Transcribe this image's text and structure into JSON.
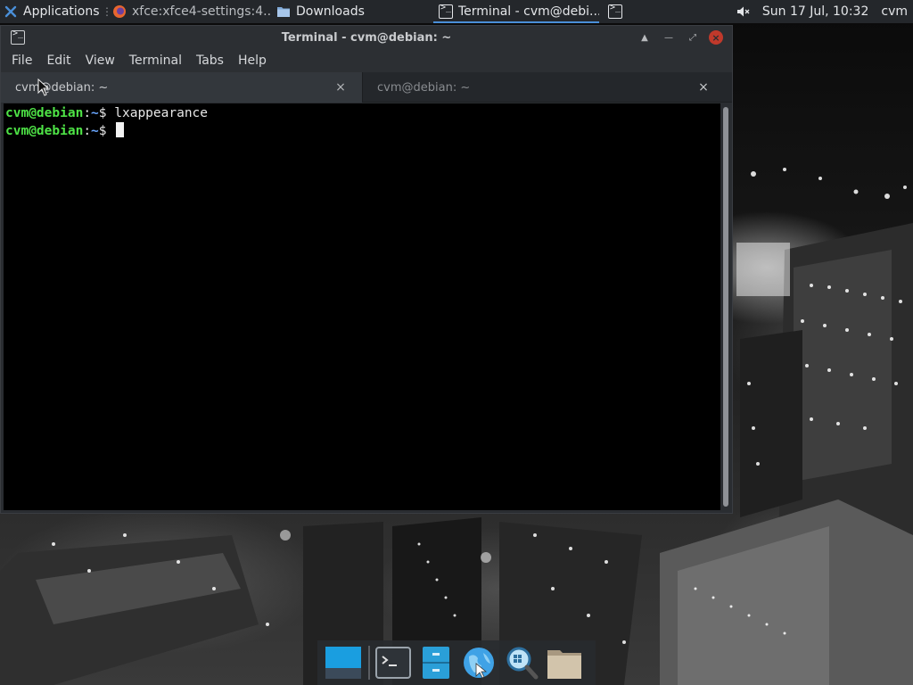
{
  "panel": {
    "applications_label": "Applications",
    "tasks": [
      {
        "label": "xfce:xfce4-settings:4...",
        "icon": "firefox-icon"
      },
      {
        "label": "Downloads",
        "icon": "folder-icon"
      },
      {
        "label": "Terminal - cvm@debi...",
        "icon": "terminal-icon"
      }
    ],
    "clock": "Sun 17 Jul, 10:32",
    "user": "cvm"
  },
  "window": {
    "title": "Terminal - cvm@debian: ~",
    "menu": [
      "File",
      "Edit",
      "View",
      "Terminal",
      "Tabs",
      "Help"
    ],
    "tabs": [
      {
        "label": "cvm@debian: ~",
        "active": true
      },
      {
        "label": "cvm@debian: ~",
        "active": false
      }
    ],
    "close_glyph": "×",
    "terminal": {
      "lines": [
        {
          "user_host": "cvm@debian",
          "sep": ":",
          "path": "~",
          "prompt": "$ ",
          "command": "lxappearance"
        },
        {
          "user_host": "cvm@debian",
          "sep": ":",
          "path": "~",
          "prompt": "$ ",
          "command": ""
        }
      ]
    }
  },
  "dock": {
    "items": [
      "show-desktop-icon",
      "terminal-icon",
      "file-manager-icon",
      "web-browser-icon",
      "app-finder-icon",
      "folder-icon"
    ]
  },
  "colors": {
    "prompt_user": "#4ee346",
    "prompt_path": "#6aa7ff",
    "accent": "#4a8fd8",
    "close_button": "#c0392b"
  }
}
